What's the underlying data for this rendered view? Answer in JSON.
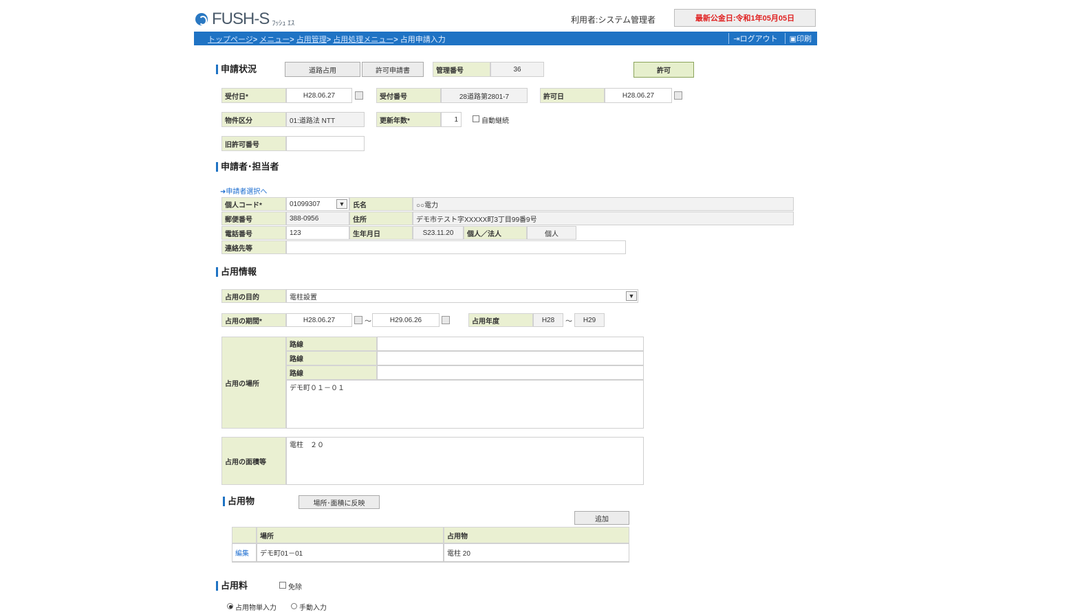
{
  "header": {
    "logo_text": "FUSH-S",
    "logo_sub": "ﾌｯｼｭ ｴｽ",
    "user_label": "利用者:システム管理者",
    "last_published": "最新公金日:令和1年05月05日"
  },
  "nav": {
    "crumbs": [
      "トップページ",
      "メニュー",
      "占用管理",
      "占用処理メニュー",
      "占用申請入力"
    ],
    "logout": "ログアウト",
    "print": "印刷"
  },
  "status_section": {
    "title": "申請状況",
    "type_tab": "道路占用",
    "doc_tab": "許可申請書",
    "mgmt_no_label": "管理番号",
    "mgmt_no_value": "36",
    "permit_button": "許可",
    "receipt_date_label": "受付日*",
    "receipt_date_value": "H28.06.27",
    "receipt_no_label": "受付番号",
    "receipt_no_value": "28道路第2801-7",
    "permit_date_label": "許可日",
    "permit_date_value": "H28.06.27",
    "category_label": "物件区分",
    "category_value": "01:道路法 NTT",
    "renew_years_label": "更新年数*",
    "renew_years_value": "1",
    "auto_renew_label": "自動継続",
    "old_permit_label": "旧許可番号",
    "old_permit_value": ""
  },
  "applicant_section": {
    "title": "申請者･担当者",
    "select_link": "申請者選択へ",
    "code_label": "個人コード*",
    "code_value": "01099307",
    "name_label": "氏名",
    "name_value": "○○電力",
    "zip_label": "郵便番号",
    "zip_value": "388-0956",
    "address_label": "住所",
    "address_value": "デモ市テスト字XXXXX町3丁目99番9号",
    "phone_label": "電話番号",
    "phone_value": "123",
    "birth_label": "生年月日",
    "birth_value": "S23.11.20",
    "type_label": "個人／法人",
    "type_value": "個人",
    "contact_label": "連絡先等",
    "contact_value": ""
  },
  "occupancy_section": {
    "title": "占用情報",
    "purpose_label": "占用の目的",
    "purpose_value": "電柱設置",
    "period_label": "占用の期間*",
    "period_from": "H28.06.27",
    "period_tilde": "～",
    "period_to": "H29.06.26",
    "year_label": "占用年度",
    "year_from": "H28",
    "year_tilde": "～",
    "year_to": "H29",
    "place_label": "占用の場所",
    "routes": [
      {
        "label": "路線",
        "value": ""
      },
      {
        "label": "路線",
        "value": ""
      },
      {
        "label": "路線",
        "value": ""
      }
    ],
    "place_text": "デモ町０１－０１",
    "area_label": "占用の面積等",
    "area_text": "電柱　２０"
  },
  "objects_section": {
    "title": "占用物",
    "reflect_button": "場所･面積に反映",
    "add_button": "追加",
    "columns": [
      "",
      "場所",
      "占用物"
    ],
    "rows": [
      {
        "edit": "編集",
        "place": "デモ町01－01",
        "object": "電柱 20"
      }
    ]
  },
  "fee_section": {
    "title": "占用料",
    "exempt_label": "免除",
    "radio_auto": "占用物単入力",
    "radio_manual": "手動入力"
  }
}
